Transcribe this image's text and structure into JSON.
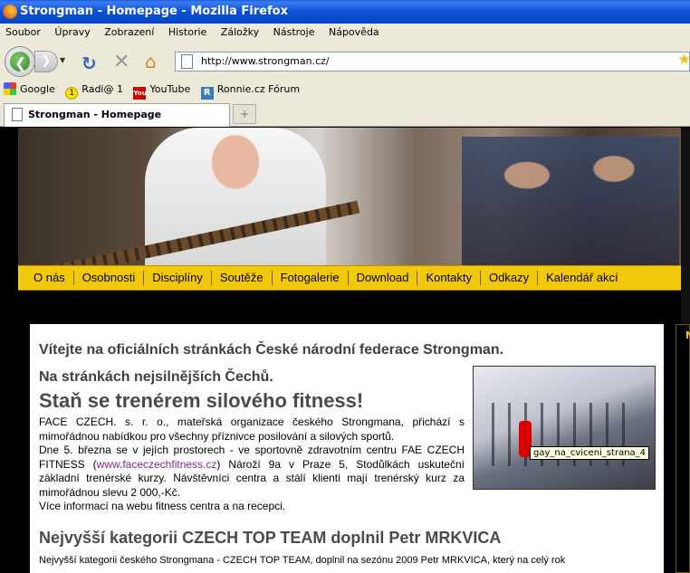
{
  "window": {
    "title": "Strongman - Homepage - Mozilla Firefox"
  },
  "menubar": {
    "items": [
      "Soubor",
      "Úpravy",
      "Zobrazení",
      "Historie",
      "Záložky",
      "Nástroje",
      "Nápověda"
    ]
  },
  "navbar": {
    "url": "http://www.strongman.cz/"
  },
  "bookmarks": [
    "Google",
    "Radi@ 1",
    "YouTube",
    "Ronnie.cz Fórum"
  ],
  "tabs": [
    {
      "label": "Strongman - Homepage"
    }
  ],
  "site": {
    "menu": [
      "O nás",
      "Osobnosti",
      "Disciplíny",
      "Soutěže",
      "Fotogalerie",
      "Download",
      "Kontakty",
      "Odkazy",
      "Kalendář akcí"
    ],
    "welcome": "Vítejte na oficiálních stránkách České národní federace Strongman.",
    "welcome2": "Na stránkách nejsilnějších Čechů.",
    "headline": "Staň se trenérem silového fitness!",
    "para1": "FACE CZECH. s. r. o., mateřská organizace českého Strongmana, přichází s mimořádnou nabídkou pro všechny příznivce posilování a silových sportů.",
    "para2_before": "Dne 5. března se v jejích prostorech - ve sportovně zdravotním centru FAE CZECH FITNESS (",
    "para2_link": "www.faceczechfitness.cz",
    "para2_after": ") Nároží 9a v Praze 5, Stodůlkách uskuteční základní trenérské kurzy. Návštěvníci centra a stálí klienti mají trenérský kurz za mimořádnou slevu 2 000,-Kč.",
    "para3": "Více informací na webu fitness centra a na recepci.",
    "image_tooltip": "gay_na_cviceni_strana_4",
    "section2": "Nejvyšší kategorii CZECH TOP TEAM doplnil Petr MRKVICA",
    "teaser": "Nejvyšší kategorii českého Strongmana - CZECH TOP TEAM, doplnil na sezónu 2009 Petr MRKVICA, který na celý rok",
    "sidebar_letter": "N"
  }
}
